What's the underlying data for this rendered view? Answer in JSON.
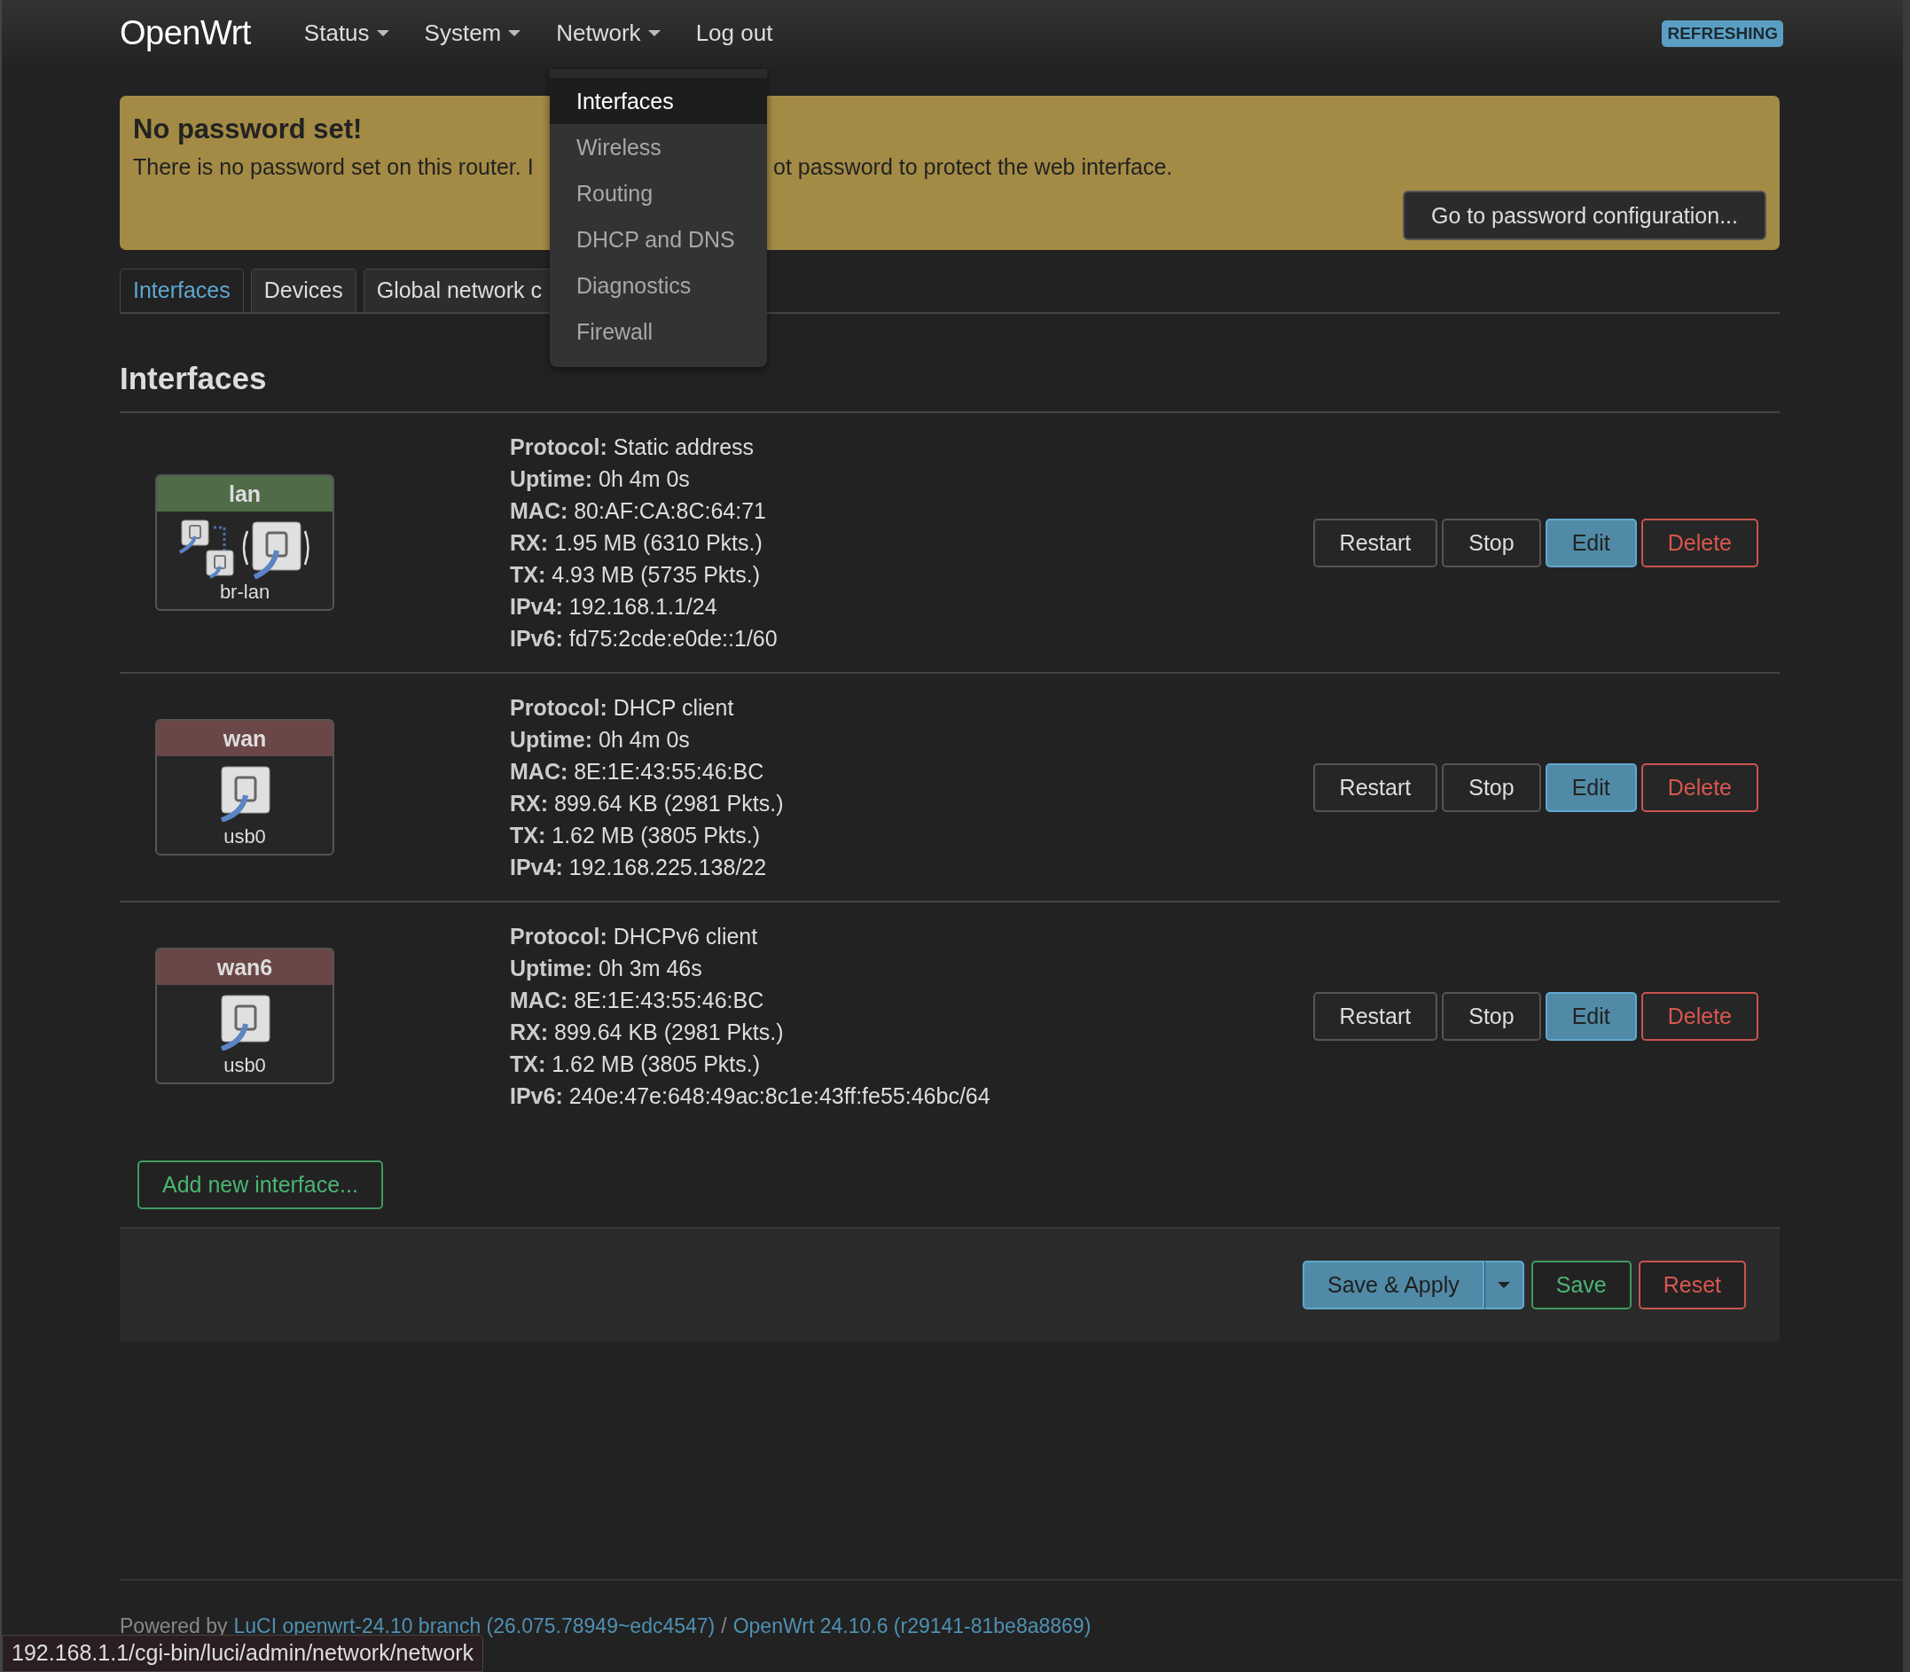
{
  "brand": "OpenWrt",
  "nav": [
    {
      "label": "Status",
      "dropdown": true
    },
    {
      "label": "System",
      "dropdown": true
    },
    {
      "label": "Network",
      "dropdown": true
    },
    {
      "label": "Log out",
      "dropdown": false
    }
  ],
  "badge": "REFRESHING",
  "menu": {
    "items": [
      {
        "label": "Interfaces",
        "selected": true
      },
      {
        "label": "Wireless",
        "selected": false
      },
      {
        "label": "Routing",
        "selected": false
      },
      {
        "label": "DHCP and DNS",
        "selected": false
      },
      {
        "label": "Diagnostics",
        "selected": false
      },
      {
        "label": "Firewall",
        "selected": false
      }
    ]
  },
  "alert": {
    "title": "No password set!",
    "text_before": "There is no password set on this router. I",
    "text_after": "ot password to protect the web interface.",
    "button": "Go to password configuration..."
  },
  "tabs": [
    {
      "label": "Interfaces",
      "selected": true
    },
    {
      "label": "Devices",
      "selected": false
    },
    {
      "label": "Global network c",
      "selected": false
    }
  ],
  "section_title": "Interfaces",
  "interfaces": [
    {
      "name": "lan",
      "color": "#4f6b47",
      "kind": "bridge",
      "device": "br-lan",
      "details": [
        {
          "label": "Protocol:",
          "value": "Static address"
        },
        {
          "label": "Uptime:",
          "value": "0h 4m 0s"
        },
        {
          "label": "MAC:",
          "value": "80:AF:CA:8C:64:71"
        },
        {
          "label": "RX:",
          "value": "1.95 MB (6310 Pkts.)"
        },
        {
          "label": "TX:",
          "value": "4.93 MB (5735 Pkts.)"
        },
        {
          "label": "IPv4:",
          "value": "192.168.1.1/24"
        },
        {
          "label": "IPv6:",
          "value": "fd75:2cde:e0de::1/60"
        }
      ],
      "actions": [
        {
          "label": "Restart",
          "kind": "default"
        },
        {
          "label": "Stop",
          "kind": "default"
        },
        {
          "label": "Edit",
          "kind": "edit"
        },
        {
          "label": "Delete",
          "kind": "delete"
        }
      ]
    },
    {
      "name": "wan",
      "color": "#6b4646",
      "kind": "port",
      "device": "usb0",
      "details": [
        {
          "label": "Protocol:",
          "value": "DHCP client"
        },
        {
          "label": "Uptime:",
          "value": "0h 4m 0s"
        },
        {
          "label": "MAC:",
          "value": "8E:1E:43:55:46:BC"
        },
        {
          "label": "RX:",
          "value": "899.64 KB (2981 Pkts.)"
        },
        {
          "label": "TX:",
          "value": "1.62 MB (3805 Pkts.)"
        },
        {
          "label": "IPv4:",
          "value": "192.168.225.138/22"
        }
      ],
      "actions": [
        {
          "label": "Restart",
          "kind": "default"
        },
        {
          "label": "Stop",
          "kind": "default"
        },
        {
          "label": "Edit",
          "kind": "edit"
        },
        {
          "label": "Delete",
          "kind": "delete"
        }
      ]
    },
    {
      "name": "wan6",
      "color": "#6b4646",
      "kind": "port",
      "device": "usb0",
      "details": [
        {
          "label": "Protocol:",
          "value": "DHCPv6 client"
        },
        {
          "label": "Uptime:",
          "value": "0h 3m 46s"
        },
        {
          "label": "MAC:",
          "value": "8E:1E:43:55:46:BC"
        },
        {
          "label": "RX:",
          "value": "899.64 KB (2981 Pkts.)"
        },
        {
          "label": "TX:",
          "value": "1.62 MB (3805 Pkts.)"
        },
        {
          "label": "IPv6:",
          "value": "240e:47e:648:49ac:8c1e:43ff:fe55:46bc/64"
        }
      ],
      "actions": [
        {
          "label": "Restart",
          "kind": "default"
        },
        {
          "label": "Stop",
          "kind": "default"
        },
        {
          "label": "Edit",
          "kind": "edit"
        },
        {
          "label": "Delete",
          "kind": "delete"
        }
      ]
    }
  ],
  "add_button": "Add new interface...",
  "footer_actions": [
    {
      "label": "Save & Apply",
      "kind": "apply"
    },
    {
      "label": "Save",
      "kind": "save"
    },
    {
      "label": "Reset",
      "kind": "reset"
    }
  ],
  "footer": [
    {
      "text": "Powered by",
      "kind": "text"
    },
    {
      "text": "LuCI openwrt-24.10 branch (26.075.78949~edc4547)",
      "kind": "link"
    },
    {
      "text": "/",
      "kind": "text"
    },
    {
      "text": "OpenWrt 24.10.6 (r29141-81be8a8869)",
      "kind": "link"
    }
  ],
  "status_url": "192.168.1.1/cgi-bin/luci/admin/network/network"
}
